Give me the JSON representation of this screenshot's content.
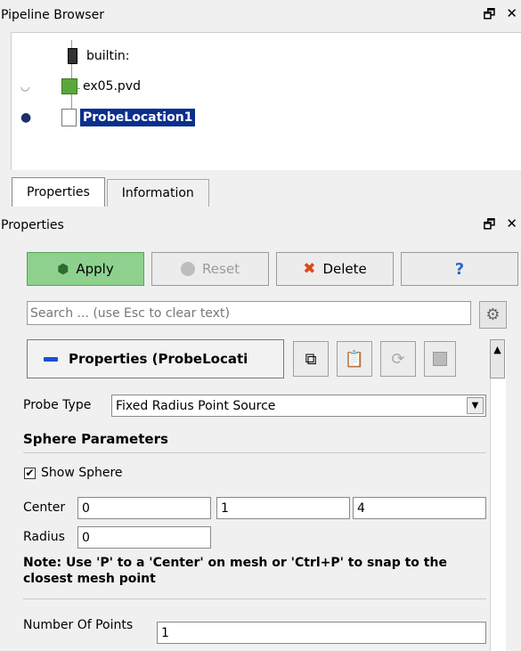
{
  "pipeline_browser": {
    "title": "Pipeline Browser",
    "items": [
      {
        "label": "builtin:"
      },
      {
        "label": "ex05.pvd"
      },
      {
        "label": "ProbeLocation1"
      }
    ]
  },
  "tabs": [
    {
      "label": "Properties"
    },
    {
      "label": "Information"
    }
  ],
  "properties_panel": {
    "title": "Properties",
    "buttons": {
      "apply": "Apply",
      "reset": "Reset",
      "delete": "Delete"
    },
    "search_placeholder": "Search ... (use Esc to clear text)",
    "section_title": "Properties (ProbeLocati",
    "probe_type": {
      "label": "Probe Type",
      "value": "Fixed Radius Point Source"
    },
    "sphere_parameters": {
      "heading": "Sphere Parameters",
      "show_sphere_label": "Show Sphere",
      "show_sphere_checked": true,
      "center_label": "Center",
      "center_values": [
        "0",
        "1",
        "4"
      ],
      "radius_label": "Radius",
      "radius_value": "0",
      "note": "Note: Use 'P' to a 'Center' on mesh or 'Ctrl+P' to snap to the closest mesh point"
    },
    "number_of_points": {
      "label": "Number Of Points",
      "value": "1"
    }
  },
  "colors": {
    "apply_bg": "#8ed18e",
    "selection_bg": "#0a2f8c",
    "accent_blue": "#1d4fd1"
  },
  "icons": [
    "restore-icon",
    "close-icon",
    "computer-icon",
    "eye-closed-icon",
    "eye-open-icon",
    "cube-icon",
    "table-icon",
    "apply-icon",
    "reset-icon",
    "delete-x-icon",
    "help-icon",
    "gear-icon",
    "copy-icon",
    "paste-icon",
    "refresh-icon",
    "save-icon"
  ]
}
